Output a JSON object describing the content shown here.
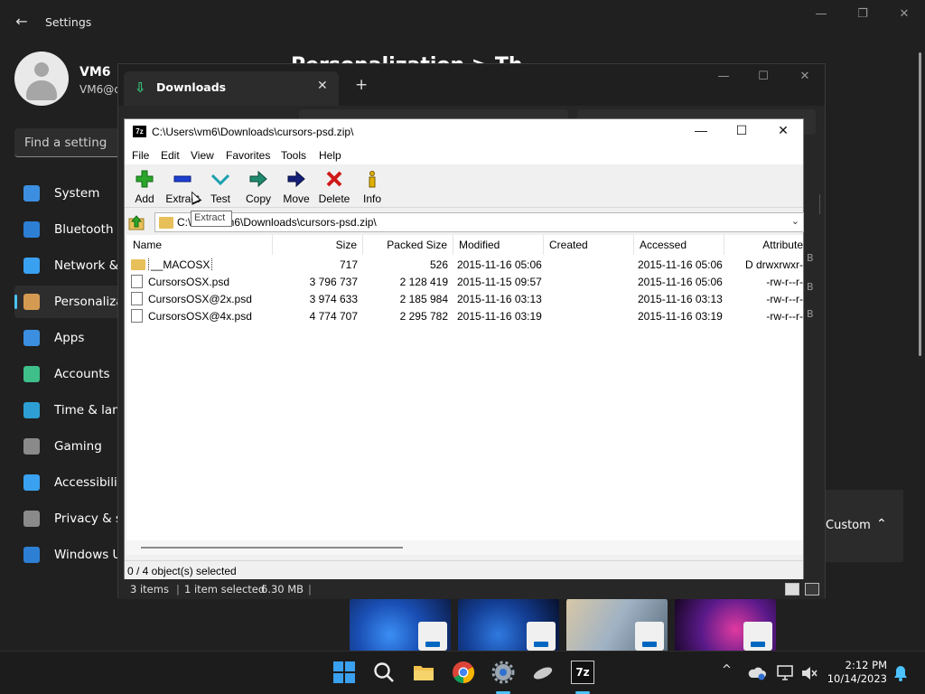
{
  "settings": {
    "title": "Settings",
    "user_name": "VM6",
    "user_email": "VM6@c",
    "search_placeholder": "Find a setting",
    "page_heading": "Personalization > Th",
    "nav": [
      {
        "label": "System",
        "icon": "monitor-icon"
      },
      {
        "label": "Bluetooth &",
        "icon": "bluetooth-icon"
      },
      {
        "label": "Network &",
        "icon": "wifi-icon"
      },
      {
        "label": "Personaliza",
        "icon": "brush-icon",
        "active": true
      },
      {
        "label": "Apps",
        "icon": "apps-icon"
      },
      {
        "label": "Accounts",
        "icon": "person-icon"
      },
      {
        "label": "Time & lang",
        "icon": "clock-globe-icon"
      },
      {
        "label": "Gaming",
        "icon": "gamepad-icon"
      },
      {
        "label": "Accessibility",
        "icon": "accessibility-icon"
      },
      {
        "label": "Privacy & se",
        "icon": "shield-icon"
      },
      {
        "label": "Windows U",
        "icon": "update-icon"
      }
    ],
    "custom_label": "Custom"
  },
  "explorer": {
    "tab_title": "Downloads",
    "right_fragments": [
      "B",
      "B",
      "B"
    ],
    "status": {
      "items": "3 items",
      "selection": "1 item selected",
      "size": "6.30 MB"
    }
  },
  "zip": {
    "title": "C:\\Users\\vm6\\Downloads\\cursors-psd.zip\\",
    "app_icon_text": "7z",
    "menus": [
      "File",
      "Edit",
      "View",
      "Favorites",
      "Tools",
      "Help"
    ],
    "toolbar": [
      {
        "label": "Add",
        "icon": "add-icon"
      },
      {
        "label": "Extract",
        "icon": "extract-icon"
      },
      {
        "label": "Test",
        "icon": "test-icon"
      },
      {
        "label": "Copy",
        "icon": "copy-icon"
      },
      {
        "label": "Move",
        "icon": "move-icon"
      },
      {
        "label": "Delete",
        "icon": "delete-icon"
      },
      {
        "label": "Info",
        "icon": "info-icon"
      }
    ],
    "path_prefix": "C:\\",
    "path_suffix": "m6\\Downloads\\cursors-psd.zip\\",
    "tooltip": "Extract",
    "columns": [
      "Name",
      "Size",
      "Packed Size",
      "Modified",
      "Created",
      "Accessed",
      "Attribute"
    ],
    "files": [
      {
        "name": "__MACOSX",
        "type": "folder",
        "size": "717",
        "packed": "526",
        "modified": "2015-11-16 05:06",
        "created": "",
        "accessed": "2015-11-16 05:06",
        "attr": "D drwxrwxr-"
      },
      {
        "name": "CursorsOSX.psd",
        "type": "file",
        "size": "3 796 737",
        "packed": "2 128 419",
        "modified": "2015-11-15 09:57",
        "created": "",
        "accessed": "2015-11-16 05:06",
        "attr": "-rw-r--r-"
      },
      {
        "name": "CursorsOSX@2x.psd",
        "type": "file",
        "size": "3 974 633",
        "packed": "2 185 984",
        "modified": "2015-11-16 03:13",
        "created": "",
        "accessed": "2015-11-16 03:13",
        "attr": "-rw-r--r-"
      },
      {
        "name": "CursorsOSX@4x.psd",
        "type": "file",
        "size": "4 774 707",
        "packed": "2 295 782",
        "modified": "2015-11-16 03:19",
        "created": "",
        "accessed": "2015-11-16 03:19",
        "attr": "-rw-r--r-"
      }
    ],
    "status": "0 / 4 object(s) selected"
  },
  "taskbar": {
    "apps": [
      "start-icon",
      "search-icon",
      "file-explorer-icon",
      "chrome-icon",
      "settings-icon",
      "mouse-app-icon",
      "7zip-icon"
    ],
    "app_7z_text": "7z",
    "tray_chevron": "^",
    "time": "2:12 PM",
    "date": "10/14/2023"
  },
  "colors": {
    "accent": "#4cc2ff",
    "settings_bg": "#202020",
    "explorer_bg": "#272727",
    "zip_bg": "#f0f0f0"
  }
}
